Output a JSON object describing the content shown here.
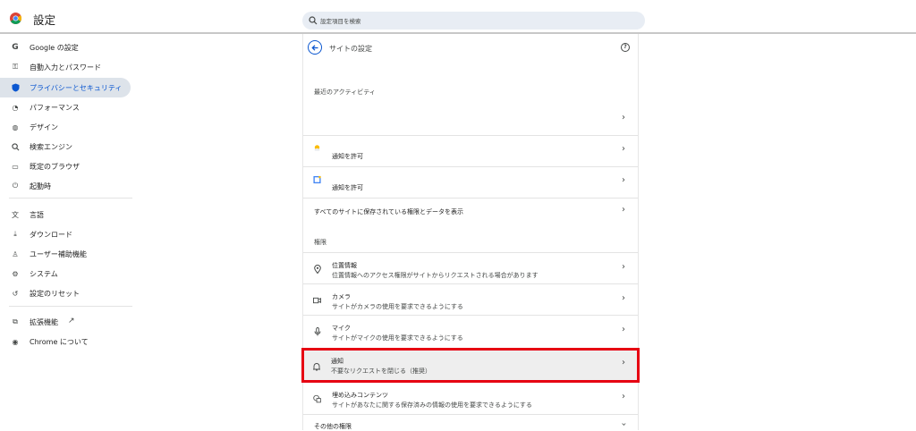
{
  "header": {
    "app_title": "設定",
    "search_placeholder": "設定項目を検索"
  },
  "sidebar": {
    "items": [
      {
        "icon": "google-g-icon",
        "label": "Google の設定"
      },
      {
        "icon": "key-icon",
        "label": "自動入力とパスワード"
      },
      {
        "icon": "shield-icon",
        "label": "プライバシーとセキュリティ",
        "active": true
      },
      {
        "icon": "gauge-icon",
        "label": "パフォーマンス"
      },
      {
        "icon": "palette-icon",
        "label": "デザイン"
      },
      {
        "icon": "search-icon",
        "label": "検索エンジン"
      },
      {
        "icon": "browser-window-icon",
        "label": "既定のブラウザ"
      },
      {
        "icon": "power-icon",
        "label": "起動時"
      },
      {
        "icon": "translate-icon",
        "label": "言語"
      },
      {
        "icon": "download-icon",
        "label": "ダウンロード"
      },
      {
        "icon": "accessibility-icon",
        "label": "ユーザー補助機能"
      },
      {
        "icon": "wrench-icon",
        "label": "システム"
      },
      {
        "icon": "reset-icon",
        "label": "設定のリセット"
      },
      {
        "icon": "puzzle-icon",
        "label": "拡張機能"
      },
      {
        "icon": "chrome-icon",
        "label": "Chrome について"
      }
    ]
  },
  "main": {
    "title": "サイトの設定",
    "recent_activity_heading": "最近のアクティビティ",
    "recent_sites": [
      {
        "icon": "sun-favicon",
        "label": "通知を許可"
      },
      {
        "icon": "calendar-favicon",
        "label": "通知を許可"
      }
    ],
    "view_all_label": "すべてのサイトに保存されている権限とデータを表示",
    "permissions_heading": "権限",
    "permissions": [
      {
        "icon": "location-pin-icon",
        "title": "位置情報",
        "subtitle": "位置情報へのアクセス権限がサイトからリクエストされる場合があります"
      },
      {
        "icon": "camera-icon",
        "title": "カメラ",
        "subtitle": "サイトがカメラの使用を要求できるようにする"
      },
      {
        "icon": "microphone-icon",
        "title": "マイク",
        "subtitle": "サイトがマイクの使用を要求できるようにする"
      },
      {
        "icon": "bell-icon",
        "title": "通知",
        "subtitle": "不要なリクエストを閉じる（推奨）"
      },
      {
        "icon": "embedded-content-icon",
        "title": "埋め込みコンテンツ",
        "subtitle": "サイトがあなたに関する保存済みの情報の使用を要求できるようにする"
      }
    ],
    "other_permissions_label": "その他の権限"
  },
  "colors": {
    "accent": "#0b57d0",
    "highlight_border": "#e60012",
    "active_nav_bg": "#dde3ea"
  }
}
